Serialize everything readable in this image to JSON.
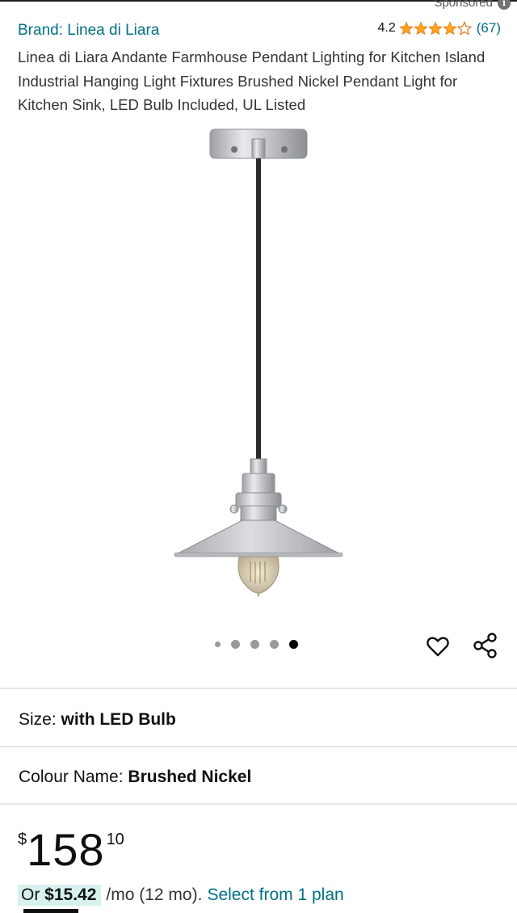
{
  "header": {
    "sponsored": "Sponsored",
    "brand": "Brand: Linea di Liara",
    "rating_value": "4.2",
    "rating_stars": 4.2,
    "rating_count": "(67)"
  },
  "product": {
    "title": "Linea di Liara Andante Farmhouse Pendant Lighting for Kitchen Island Industrial Hanging Light Fixtures Brushed Nickel Pendant Light for Kitchen Sink, LED Bulb Included, UL Listed"
  },
  "gallery": {
    "image_count": 5,
    "active_index": 4
  },
  "options": {
    "size_label": "Size:",
    "size_value": "with LED Bulb",
    "colour_label": "Colour Name:",
    "colour_value": "Brushed Nickel"
  },
  "price": {
    "symbol": "$",
    "whole": "158",
    "fraction": "10"
  },
  "installment": {
    "prefix": "Or",
    "amount": "$15.42",
    "term": "/mo (12 mo).",
    "link": "Select from 1 plan"
  },
  "colors": {
    "link": "#007185",
    "star": "#ffa41c",
    "pill": "#d7f2ee"
  }
}
